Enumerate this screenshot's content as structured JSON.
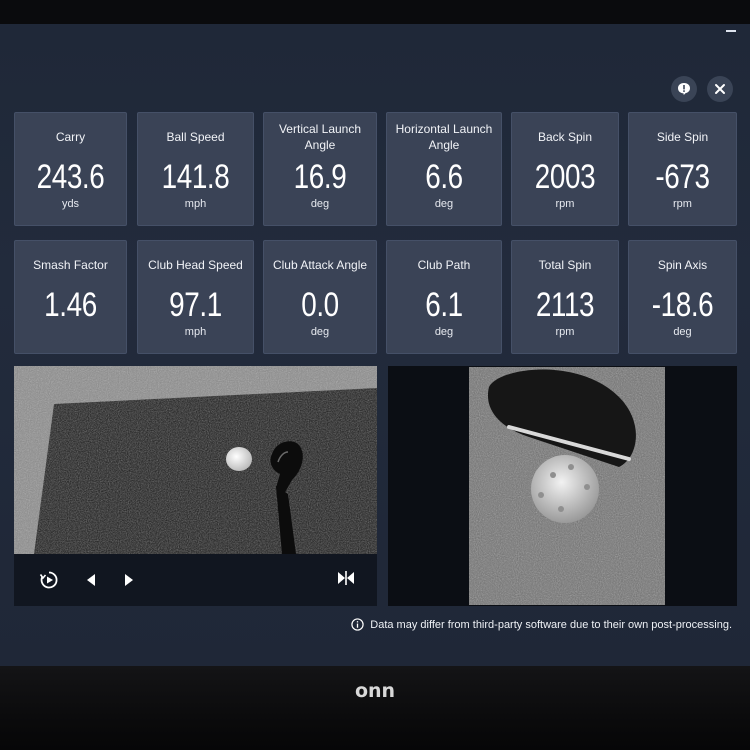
{
  "window": {
    "minimize_icon": "minimize-icon"
  },
  "header": {
    "feedback_icon": "feedback-icon",
    "close_icon": "close-icon"
  },
  "metrics_row1": [
    {
      "label": "Carry",
      "value": "243.6",
      "unit": "yds"
    },
    {
      "label": "Ball Speed",
      "value": "141.8",
      "unit": "mph"
    },
    {
      "label": "Vertical Launch Angle",
      "value": "16.9",
      "unit": "deg"
    },
    {
      "label": "Horizontal Launch Angle",
      "value": "6.6",
      "unit": "deg"
    },
    {
      "label": "Back Spin",
      "value": "2003",
      "unit": "rpm"
    },
    {
      "label": "Side Spin",
      "value": "-673",
      "unit": "rpm"
    }
  ],
  "metrics_row2": [
    {
      "label": "Smash Factor",
      "value": "1.46",
      "unit": ""
    },
    {
      "label": "Club Head Speed",
      "value": "97.1",
      "unit": "mph"
    },
    {
      "label": "Club Attack Angle",
      "value": "0.0",
      "unit": "deg"
    },
    {
      "label": "Club Path",
      "value": "6.1",
      "unit": "deg"
    },
    {
      "label": "Total Spin",
      "value": "2113",
      "unit": "rpm"
    },
    {
      "label": "Spin Axis",
      "value": "-18.6",
      "unit": "deg"
    }
  ],
  "video_controls": {
    "replay_icon": "replay-icon",
    "prev_icon": "previous-frame-icon",
    "next_icon": "next-frame-icon",
    "split_icon": "split-view-icon"
  },
  "notice": {
    "text": "Data may differ from third-party software due to their own post-processing."
  },
  "device": {
    "brand": "onn"
  },
  "colors": {
    "background": "#222b3c",
    "tile": "#3a4356",
    "controls_bar": "#111620"
  }
}
